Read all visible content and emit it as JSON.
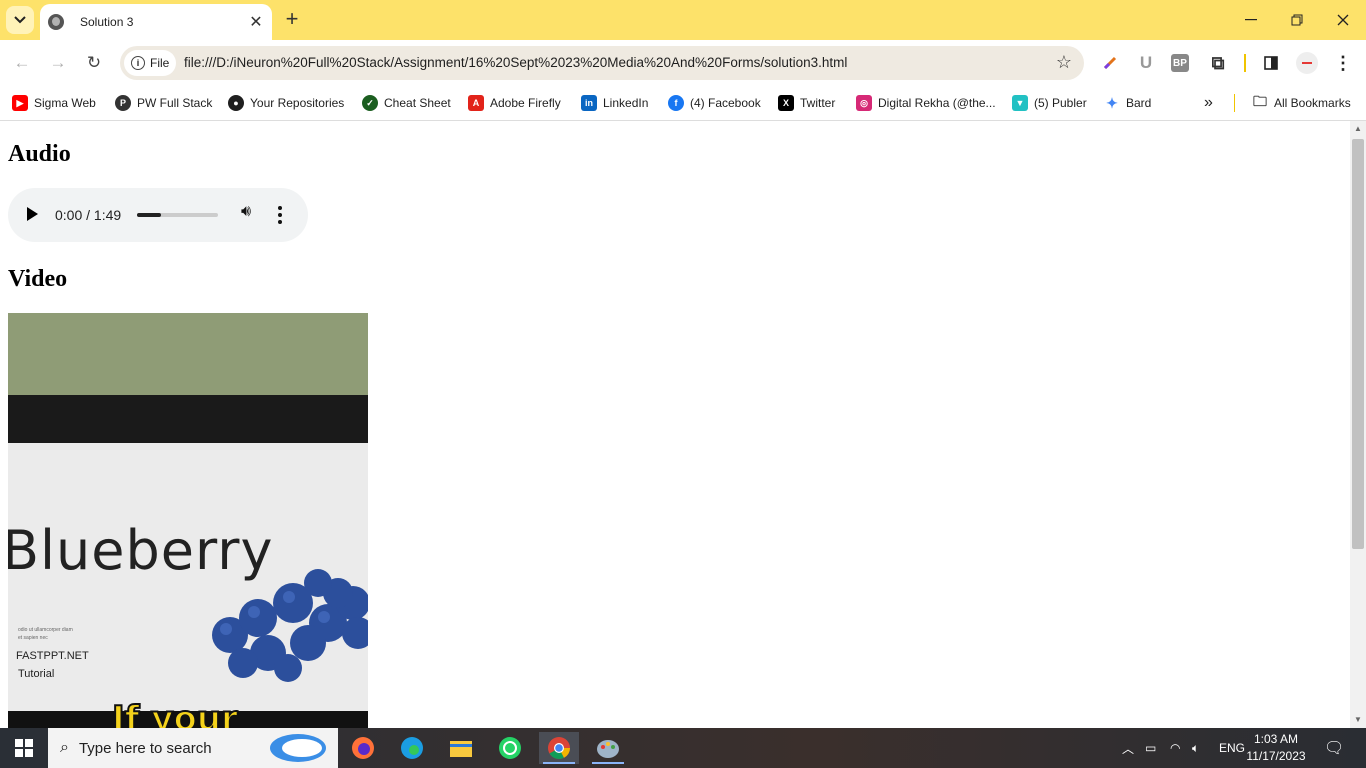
{
  "browser": {
    "tab_title": "Solution 3",
    "address_chip": "File",
    "url": "file:///D:/iNeuron%20Full%20Stack/Assignment/16%20Sept%2023%20Media%20And%20Forms/solution3.html",
    "ext_bp": "BP",
    "ext_u": "U"
  },
  "bookmarks": [
    {
      "label": "Sigma Web",
      "icon": "youtube-icon",
      "color": "#ff0000"
    },
    {
      "label": "PW Full Stack",
      "icon": "pw-icon",
      "color": "#333333"
    },
    {
      "label": "Your Repositories",
      "icon": "github-icon",
      "color": "#1f1f1f"
    },
    {
      "label": "Cheat Sheet",
      "icon": "cheatsheet-icon",
      "color": "#1b5e20"
    },
    {
      "label": "Adobe Firefly",
      "icon": "adobe-icon",
      "color": "#e2231a"
    },
    {
      "label": "LinkedIn",
      "icon": "linkedin-icon",
      "color": "#0a66c2"
    },
    {
      "label": "(4) Facebook",
      "icon": "facebook-icon",
      "color": "#1877f2"
    },
    {
      "label": "Twitter",
      "icon": "x-icon",
      "color": "#000000"
    },
    {
      "label": "Digital Rekha (@the...",
      "icon": "instagram-icon",
      "color": "#d62976"
    },
    {
      "label": "(5) Publer",
      "icon": "publer-icon",
      "color": "#22c1c3"
    },
    {
      "label": "Bard",
      "icon": "bard-icon",
      "color": "#4285f4"
    }
  ],
  "all_bookmarks": "All Bookmarks",
  "page": {
    "audio_heading": "Audio",
    "video_heading": "Video",
    "audio_time": "0:00 / 1:49",
    "audio_progress": 0.3
  },
  "video_frame": {
    "product": "Blueberry",
    "brand": "FASTPPT.NET",
    "sub": "Tutorial",
    "caption": "If your"
  },
  "taskbar": {
    "search_placeholder": "Type here to search",
    "lang": "ENG",
    "time": "1:03 AM",
    "date": "11/17/2023"
  }
}
